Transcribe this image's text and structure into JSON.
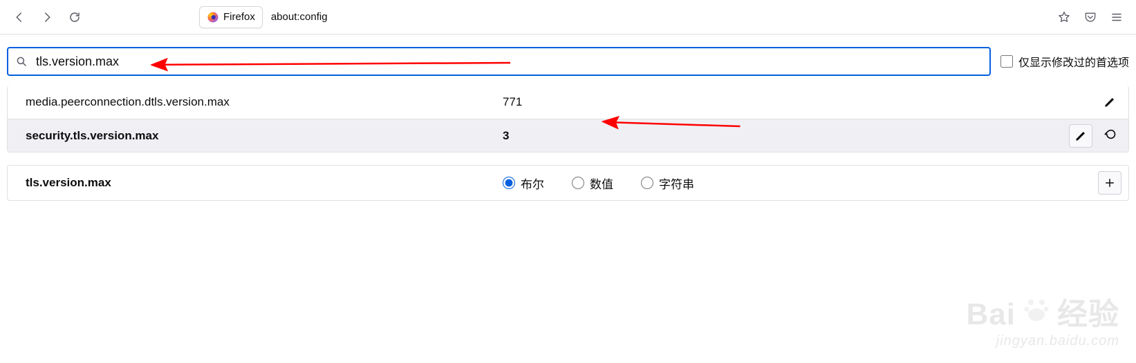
{
  "browser": {
    "tab_label": "Firefox",
    "url": "about:config"
  },
  "search": {
    "value": "tls.version.max",
    "only_modified_label": "仅显示修改过的首选项"
  },
  "prefs": [
    {
      "name": "media.peerconnection.dtls.version.max",
      "value": "771",
      "modified": false,
      "has_reset": false
    },
    {
      "name": "security.tls.version.max",
      "value": "3",
      "modified": true,
      "has_reset": true
    }
  ],
  "newpref": {
    "name": "tls.version.max",
    "types": {
      "bool": "布尔",
      "number": "数值",
      "string": "字符串"
    },
    "selected": "bool"
  },
  "watermark": {
    "brand_a": "Bai",
    "brand_b": "经验",
    "sub": "jingyan.baidu.com"
  }
}
